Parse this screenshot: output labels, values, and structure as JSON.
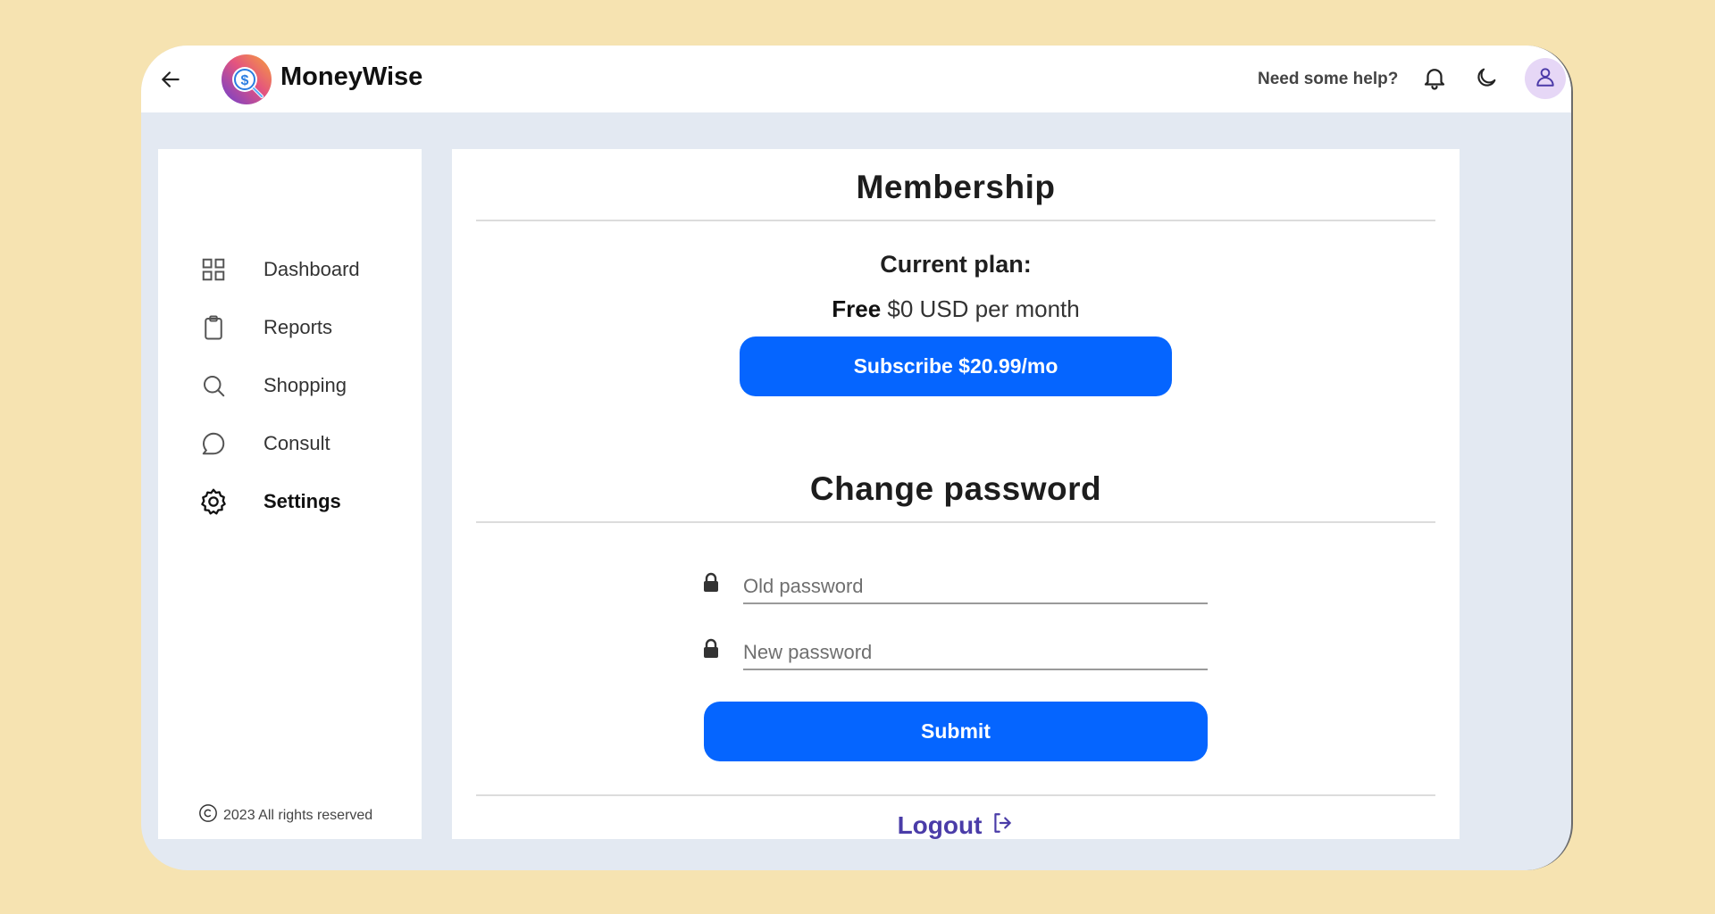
{
  "header": {
    "brand": "MoneyWise",
    "help_label": "Need some help?"
  },
  "sidebar": {
    "items": [
      {
        "label": "Dashboard",
        "icon": "grid-icon"
      },
      {
        "label": "Reports",
        "icon": "clipboard-icon"
      },
      {
        "label": "Shopping",
        "icon": "search-icon"
      },
      {
        "label": "Consult",
        "icon": "chat-bubble-icon"
      },
      {
        "label": "Settings",
        "icon": "gear-icon",
        "active": true
      }
    ],
    "copyright": "2023 All rights reserved"
  },
  "membership": {
    "title": "Membership",
    "current_plan_label": "Current plan:",
    "plan_name": "Free",
    "plan_price": "$0 USD per month",
    "subscribe_label": "Subscribe $20.99/mo"
  },
  "password": {
    "title": "Change password",
    "old_placeholder": "Old password",
    "new_placeholder": "New password",
    "submit_label": "Submit"
  },
  "logout": {
    "label": "Logout"
  },
  "colors": {
    "accent": "#0565ff",
    "page_background": "#f6e3b1",
    "app_background": "#e3e9f2",
    "avatar_background": "#e6d7f6"
  }
}
